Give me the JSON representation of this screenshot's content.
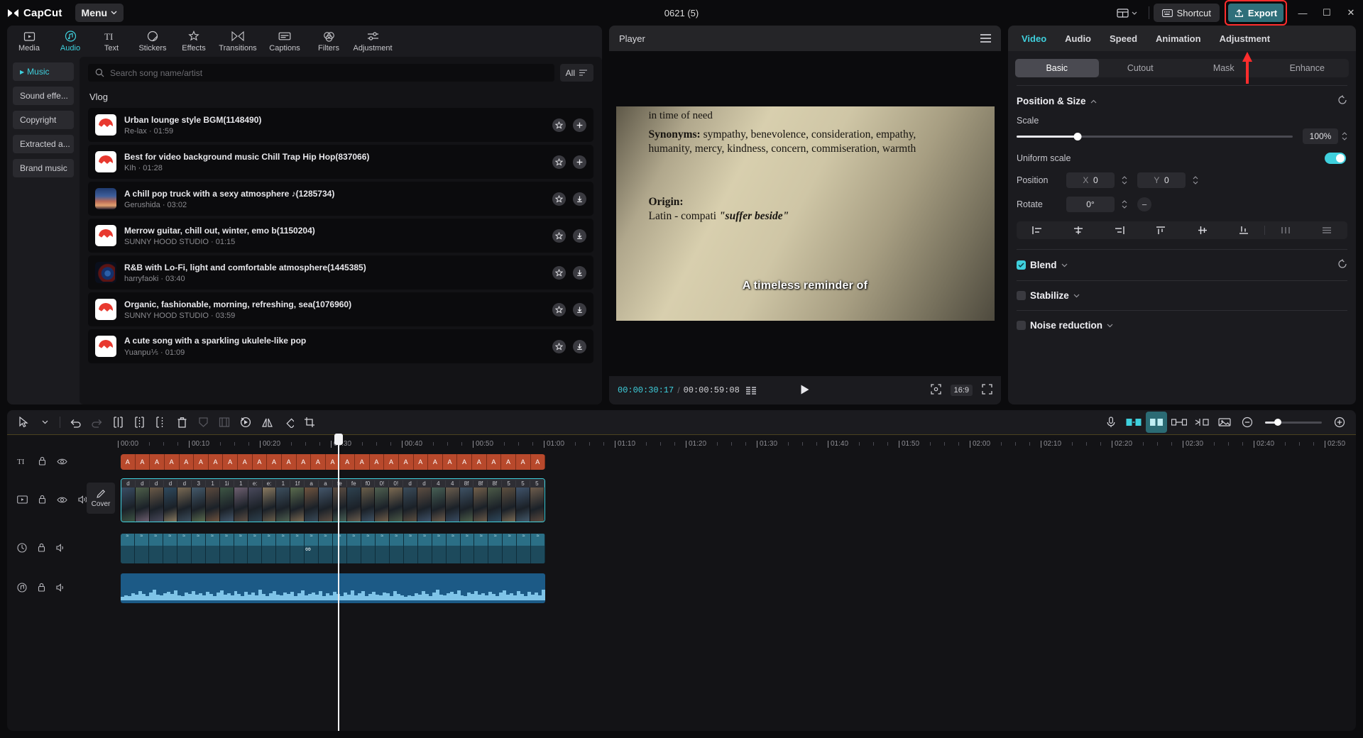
{
  "titlebar": {
    "app_name": "CapCut",
    "menu_label": "Menu",
    "project_title": "0621 (5)",
    "layout_icon": "layout-icon",
    "shortcut_label": "Shortcut",
    "export_label": "Export",
    "minimize": "—",
    "maximize": "☐",
    "close": "✕",
    "export_highlight_color": "#ff2d2d",
    "accent_color": "#3fd0dd"
  },
  "nav_tabs": [
    {
      "label": "Media",
      "icon": "media-icon",
      "active": false
    },
    {
      "label": "Audio",
      "icon": "audio-icon",
      "active": true
    },
    {
      "label": "Text",
      "icon": "text-icon",
      "active": false
    },
    {
      "label": "Stickers",
      "icon": "stickers-icon",
      "active": false
    },
    {
      "label": "Effects",
      "icon": "effects-icon",
      "active": false
    },
    {
      "label": "Transitions",
      "icon": "transitions-icon",
      "active": false
    },
    {
      "label": "Captions",
      "icon": "captions-icon",
      "active": false
    },
    {
      "label": "Filters",
      "icon": "filters-icon",
      "active": false
    },
    {
      "label": "Adjustment",
      "icon": "adjustment-icon",
      "active": false
    }
  ],
  "subnav": [
    {
      "label": "Music",
      "active": true
    },
    {
      "label": "Sound effe...",
      "active": false
    },
    {
      "label": "Copyright",
      "active": false
    },
    {
      "label": "Extracted a...",
      "active": false
    },
    {
      "label": "Brand music",
      "active": false
    }
  ],
  "search": {
    "placeholder": "Search song name/artist",
    "value": "",
    "icon": "search-icon"
  },
  "filter": {
    "label": "All",
    "icon": "filter-icon"
  },
  "category_title": "Vlog",
  "songs": [
    {
      "name": "Urban lounge style BGM(1148490)",
      "artist": "Re-lax",
      "duration": "01:59",
      "thumb": "red",
      "action": "add"
    },
    {
      "name": "Best for video background music Chill Trap Hip Hop(837066)",
      "artist": "KIh",
      "duration": "01:28",
      "thumb": "red",
      "action": "add"
    },
    {
      "name": "A chill pop truck with a sexy atmosphere ♪(1285734)",
      "artist": "Gerushida",
      "duration": "03:02",
      "thumb": "sky",
      "action": "download"
    },
    {
      "name": "Merrow guitar, chill out, winter, emo b(1150204)",
      "artist": "SUNNY HOOD STUDIO",
      "duration": "01:15",
      "thumb": "red",
      "action": "download"
    },
    {
      "name": "R&B with Lo-Fi, light and comfortable atmosphere(1445385)",
      "artist": "harryfaoki",
      "duration": "03:40",
      "thumb": "dark",
      "action": "download"
    },
    {
      "name": "Organic, fashionable, morning, refreshing, sea(1076960)",
      "artist": "SUNNY HOOD STUDIO",
      "duration": "03:59",
      "thumb": "red",
      "action": "download"
    },
    {
      "name": "A cute song with a sparkling ukulele-like pop",
      "artist": "Yuanpu⅕ · 01:09",
      "duration": "",
      "thumb": "red",
      "action": "download"
    }
  ],
  "player": {
    "title": "Player",
    "menu_icon": "hamburger-icon",
    "current_time": "00:00:30:17",
    "separator": "/",
    "total_time": "00:00:59:08",
    "play_icon": "play-icon",
    "crop_icon": "crop-icon",
    "ratio_label": "16:9",
    "fullscreen_icon": "fullscreen-icon",
    "video_line_1": "in time of need",
    "video_line_2_head": "Synonyms:",
    "video_line_2": " sympathy, benevolence, consideration, empathy, humanity, mercy, kindness, concern, commiseration, warmth",
    "video_line_3_head": "Origin:",
    "video_line_3a": "Latin - compati ",
    "video_line_3b": "\"suffer beside\"",
    "caption": "A timeless reminder of"
  },
  "properties": {
    "tabs": [
      {
        "label": "Video",
        "active": true
      },
      {
        "label": "Audio",
        "active": false
      },
      {
        "label": "Speed",
        "active": false
      },
      {
        "label": "Animation",
        "active": false
      },
      {
        "label": "Adjustment",
        "active": false
      }
    ],
    "segments": [
      {
        "label": "Basic",
        "active": true
      },
      {
        "label": "Cutout",
        "active": false
      },
      {
        "label": "Mask",
        "active": false
      },
      {
        "label": "Enhance",
        "active": false
      }
    ],
    "position_size": {
      "title": "Position & Size",
      "reset_icon": "reset-icon",
      "collapse_icon": "chevron-up-icon",
      "scale_label": "Scale",
      "scale_value": "100%",
      "scale_percent": 22,
      "uniform_scale_label": "Uniform scale",
      "uniform_scale_on": true,
      "position_label": "Position",
      "position_x_label": "X",
      "position_x": "0",
      "position_y_label": "Y",
      "position_y": "0",
      "rotate_label": "Rotate",
      "rotate_value": "0°",
      "align_icons": [
        "align-left-icon",
        "align-center-horizontal-icon",
        "align-right-icon",
        "align-top-icon",
        "align-center-vertical-icon",
        "align-bottom-icon",
        "distribute-horizontal-icon",
        "distribute-vertical-icon"
      ]
    },
    "blend": {
      "label": "Blend",
      "checked": true,
      "reset_icon": "reset-icon"
    },
    "stabilize": {
      "label": "Stabilize",
      "checked": false
    },
    "noise_reduction": {
      "label": "Noise reduction",
      "checked": false
    }
  },
  "timeline": {
    "tools_left": [
      {
        "icon": "select-arrow-icon",
        "name": "select-tool",
        "state": "normal"
      },
      {
        "icon": "chevron-down-icon",
        "name": "select-dropdown",
        "state": "normal"
      },
      {
        "icon": "undo-icon",
        "name": "undo",
        "state": "normal"
      },
      {
        "icon": "redo-icon",
        "name": "redo",
        "state": "dim"
      },
      {
        "icon": "split-icon",
        "name": "split",
        "state": "normal"
      },
      {
        "icon": "trim-left-icon",
        "name": "trim-left",
        "state": "normal"
      },
      {
        "icon": "trim-right-icon",
        "name": "trim-right",
        "state": "normal"
      },
      {
        "icon": "delete-icon",
        "name": "delete",
        "state": "normal"
      },
      {
        "icon": "shield-icon",
        "name": "freeze",
        "state": "dim"
      },
      {
        "icon": "mirror-frame-icon",
        "name": "split-screen",
        "state": "dim"
      },
      {
        "icon": "reverse-icon",
        "name": "reverse",
        "state": "normal"
      },
      {
        "icon": "mirror-icon",
        "name": "mirror",
        "state": "normal"
      },
      {
        "icon": "rotate-icon",
        "name": "rotate",
        "state": "normal"
      },
      {
        "icon": "crop-icon",
        "name": "crop",
        "state": "normal"
      }
    ],
    "tools_right": [
      {
        "icon": "microphone-icon",
        "name": "record",
        "state": "normal"
      },
      {
        "icon": "auto-cut-icon",
        "name": "auto-cut",
        "state": "cyan"
      },
      {
        "icon": "manual-cut-icon",
        "name": "manual-cut",
        "state": "selected"
      },
      {
        "icon": "link-icon",
        "name": "link-clips",
        "state": "normal"
      },
      {
        "icon": "detach-icon",
        "name": "detach-audio",
        "state": "normal"
      },
      {
        "icon": "cover-icon",
        "name": "cover",
        "state": "normal"
      },
      {
        "icon": "zoom-out-icon",
        "name": "zoom-out",
        "state": "normal"
      },
      {
        "icon": "zoom-in-icon",
        "name": "zoom-in",
        "state": "normal"
      },
      {
        "icon": "fit-icon",
        "name": "fit-timeline",
        "state": "normal"
      }
    ],
    "zoom_percent": 22,
    "ruler_ticks": [
      "00:00",
      "00:10",
      "00:20",
      "00:30",
      "00:40",
      "00:50",
      "01:00",
      "01:10",
      "01:20",
      "01:30",
      "01:40",
      "01:50",
      "02:00",
      "02:10",
      "02:20",
      "02:30",
      "02:40",
      "02:50"
    ],
    "playhead_time": "00:30",
    "cover_label": "Cover",
    "cover_icon": "pencil-icon",
    "track_controls": [
      {
        "icon": "text-track-icon",
        "lock": "lock-icon",
        "visibility": "eye-icon"
      },
      {
        "icon": "video-track-icon",
        "lock": "lock-icon",
        "visibility": "eye-icon",
        "mute": "speaker-icon"
      },
      {
        "icon": "effect-track-icon",
        "lock": "lock-icon",
        "mute": "speaker-icon"
      },
      {
        "icon": "audio-track-icon",
        "lock": "lock-icon",
        "mute": "speaker-icon"
      }
    ],
    "text_clip_labels": [
      "A",
      "A",
      "A",
      "A",
      "A",
      "A",
      "A",
      "A",
      "A",
      "A",
      "A",
      "A",
      "A",
      "A",
      "A",
      "A",
      "A",
      "A",
      "A",
      "A",
      "A",
      "A",
      "A",
      "A",
      "A",
      "A",
      "A",
      "A",
      "A"
    ],
    "video_clip_labels": [
      "d",
      "d",
      "d",
      "d",
      "d",
      "3",
      "1",
      "1i",
      "1",
      "e:",
      "e:",
      "1",
      "1f",
      "a",
      "a",
      "fe",
      "fe",
      "f0",
      "0!",
      "0!",
      "d",
      "d",
      "4",
      "4",
      "8f",
      "8f",
      "8f",
      "5",
      "5",
      "5"
    ],
    "infinity_marker": "∞"
  }
}
